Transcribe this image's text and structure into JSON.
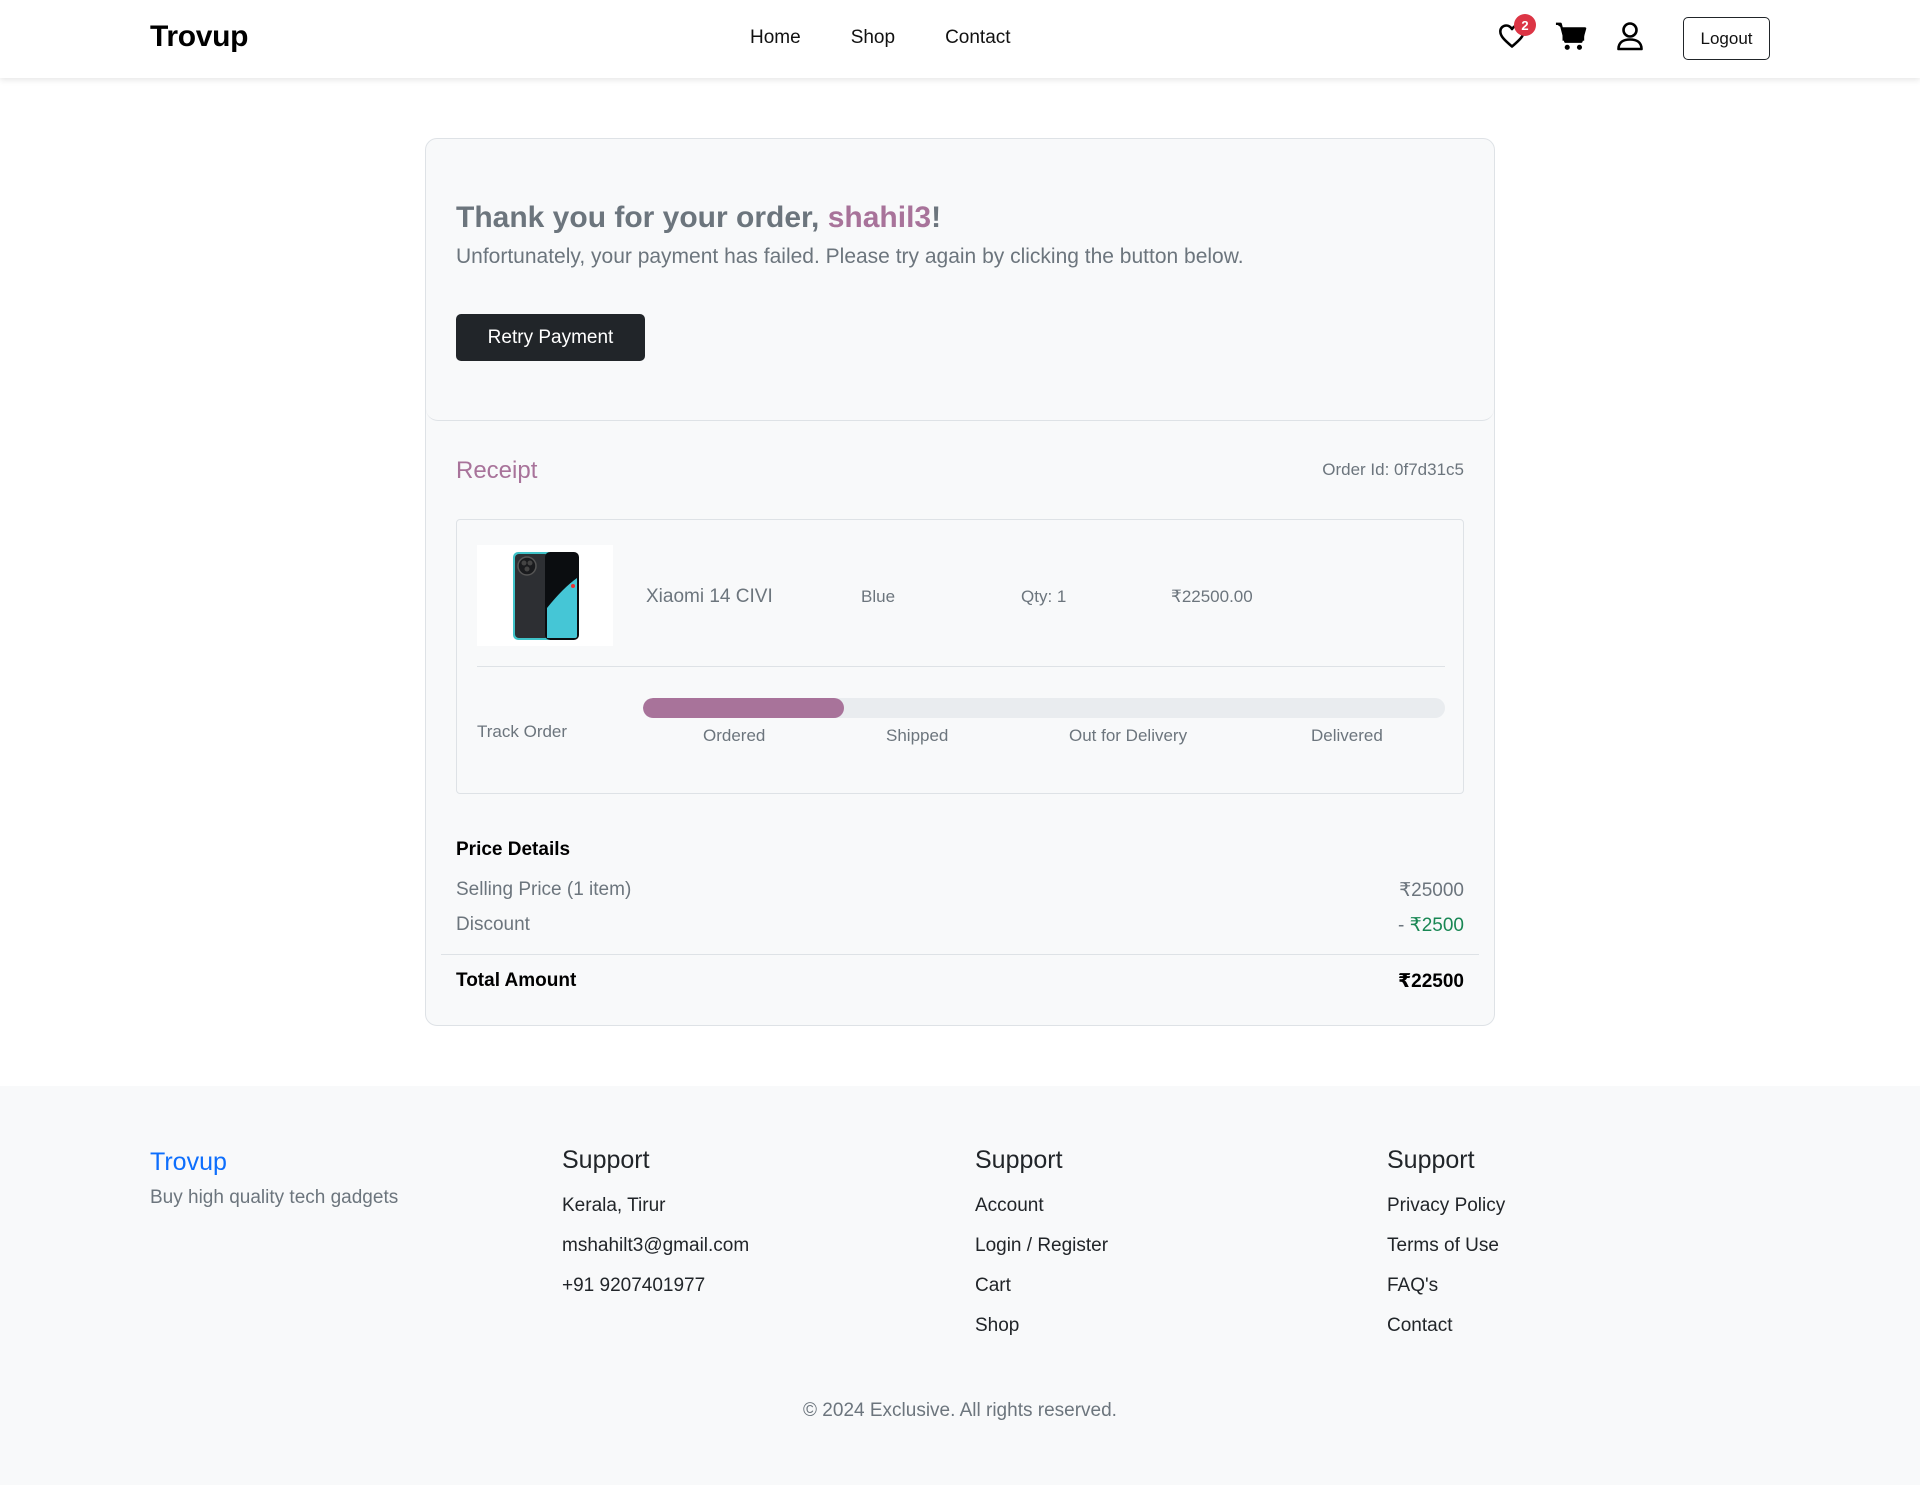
{
  "header": {
    "brand": "Trovup",
    "nav": [
      "Home",
      "Shop",
      "Contact"
    ],
    "wishlist_count": "2",
    "logout_label": "Logout",
    "icons": [
      "heart-icon",
      "cart-icon",
      "user-icon"
    ]
  },
  "order": {
    "thanks_prefix": "Thank you for your order, ",
    "username": "shahil3",
    "thanks_suffix": "!",
    "failure_message": "Unfortunately, your payment has failed. Please try again by clicking the button below.",
    "retry_label": "Retry Payment",
    "receipt_title": "Receipt",
    "order_id": "Order Id: 0f7d31c5"
  },
  "item": {
    "name": "Xiaomi 14 CIVI",
    "color": "Blue",
    "qty": "Qty: 1",
    "price": "₹22500.00",
    "image_alt": "phone-product-image"
  },
  "tracking": {
    "label": "Track Order",
    "progress_percent": 25,
    "steps": [
      "Ordered",
      "Shipped",
      "Out for Delivery",
      "Delivered"
    ]
  },
  "price_details": {
    "title": "Price Details",
    "selling_label": "Selling Price (1 item)",
    "selling_value": "₹25000",
    "discount_label": "Discount",
    "discount_value": "- ₹2500",
    "total_label": "Total Amount",
    "total_value": "₹22500"
  },
  "footer": {
    "brand": "Trovup",
    "tagline": "Buy high quality tech gadgets",
    "columns": [
      {
        "title": "Support",
        "items": [
          "Kerala, Tirur",
          "mshahilt3@gmail.com",
          "+91 9207401977"
        ]
      },
      {
        "title": "Support",
        "items": [
          "Account",
          "Login / Register",
          "Cart",
          "Shop"
        ]
      },
      {
        "title": "Support",
        "items": [
          "Privacy Policy",
          "Terms of Use",
          "FAQ's",
          "Contact"
        ]
      }
    ],
    "copyright": "© 2024 Exclusive. All rights reserved."
  },
  "colors": {
    "accent": "#a8739a",
    "dark_button": "#212529",
    "badge": "#dc3545",
    "discount": "#198754",
    "footer_brand": "#0d6efd"
  }
}
